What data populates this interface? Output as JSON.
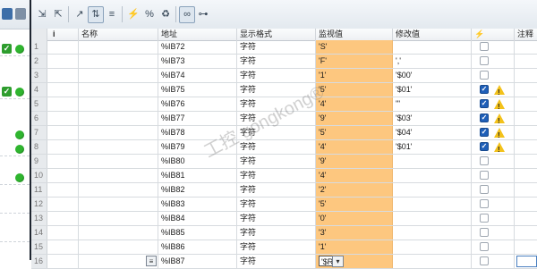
{
  "header": {
    "col_i": "i",
    "col_name": "名称",
    "col_addr": "地址",
    "col_fmt": "显示格式",
    "col_mon": "监视值",
    "col_mod": "修改值",
    "col_flag": "⚡",
    "col_note": "注释"
  },
  "rows": [
    {
      "n": "1",
      "addr": "%IB72",
      "fmt": "字符",
      "mon": "'S'",
      "mod": "",
      "chk": false,
      "warn": false
    },
    {
      "n": "2",
      "addr": "%IB73",
      "fmt": "字符",
      "mon": "'F'",
      "mod": "','",
      "chk": false,
      "warn": false
    },
    {
      "n": "3",
      "addr": "%IB74",
      "fmt": "字符",
      "mon": "'1'",
      "mod": "'$00'",
      "chk": false,
      "warn": false
    },
    {
      "n": "4",
      "addr": "%IB75",
      "fmt": "字符",
      "mon": "'5'",
      "mod": "'$01'",
      "chk": true,
      "warn": true
    },
    {
      "n": "5",
      "addr": "%IB76",
      "fmt": "字符",
      "mon": "'4'",
      "mod": "'''",
      "chk": true,
      "warn": true
    },
    {
      "n": "6",
      "addr": "%IB77",
      "fmt": "字符",
      "mon": "'9'",
      "mod": "'$03'",
      "chk": true,
      "warn": true
    },
    {
      "n": "7",
      "addr": "%IB78",
      "fmt": "字符",
      "mon": "'5'",
      "mod": "'$04'",
      "chk": true,
      "warn": true
    },
    {
      "n": "8",
      "addr": "%IB79",
      "fmt": "字符",
      "mon": "'4'",
      "mod": "'$01'",
      "chk": true,
      "warn": true
    },
    {
      "n": "9",
      "addr": "%IB80",
      "fmt": "字符",
      "mon": "'9'",
      "mod": "",
      "chk": false,
      "warn": false
    },
    {
      "n": "10",
      "addr": "%IB81",
      "fmt": "字符",
      "mon": "'4'",
      "mod": "",
      "chk": false,
      "warn": false
    },
    {
      "n": "11",
      "addr": "%IB82",
      "fmt": "字符",
      "mon": "'2'",
      "mod": "",
      "chk": false,
      "warn": false
    },
    {
      "n": "12",
      "addr": "%IB83",
      "fmt": "字符",
      "mon": "'5'",
      "mod": "",
      "chk": false,
      "warn": false
    },
    {
      "n": "13",
      "addr": "%IB84",
      "fmt": "字符",
      "mon": "'0'",
      "mod": "",
      "chk": false,
      "warn": false
    },
    {
      "n": "14",
      "addr": "%IB85",
      "fmt": "字符",
      "mon": "'3'",
      "mod": "",
      "chk": false,
      "warn": false
    },
    {
      "n": "15",
      "addr": "%IB86",
      "fmt": "字符",
      "mon": "'1'",
      "mod": "",
      "chk": false,
      "warn": false
    },
    {
      "n": "16",
      "addr": "%IB87",
      "fmt": "字符",
      "mon": "'$R'",
      "mod": "",
      "chk": false,
      "warn": false
    }
  ],
  "left_status": {
    "row1": {
      "check": true,
      "dot": true
    },
    "row4": {
      "check": true,
      "dot": true
    },
    "row7": {
      "check": false,
      "dot": true
    },
    "row8": {
      "check": false,
      "dot": true
    },
    "row10": {
      "check": false,
      "dot": true
    }
  },
  "watermark": "工控 gongkong®",
  "colors": {
    "monitor_bg": "#fdc77f",
    "checkbox_on": "#1f5fb8",
    "warning": "#f3c21b",
    "status_green": "#2fb52f"
  }
}
